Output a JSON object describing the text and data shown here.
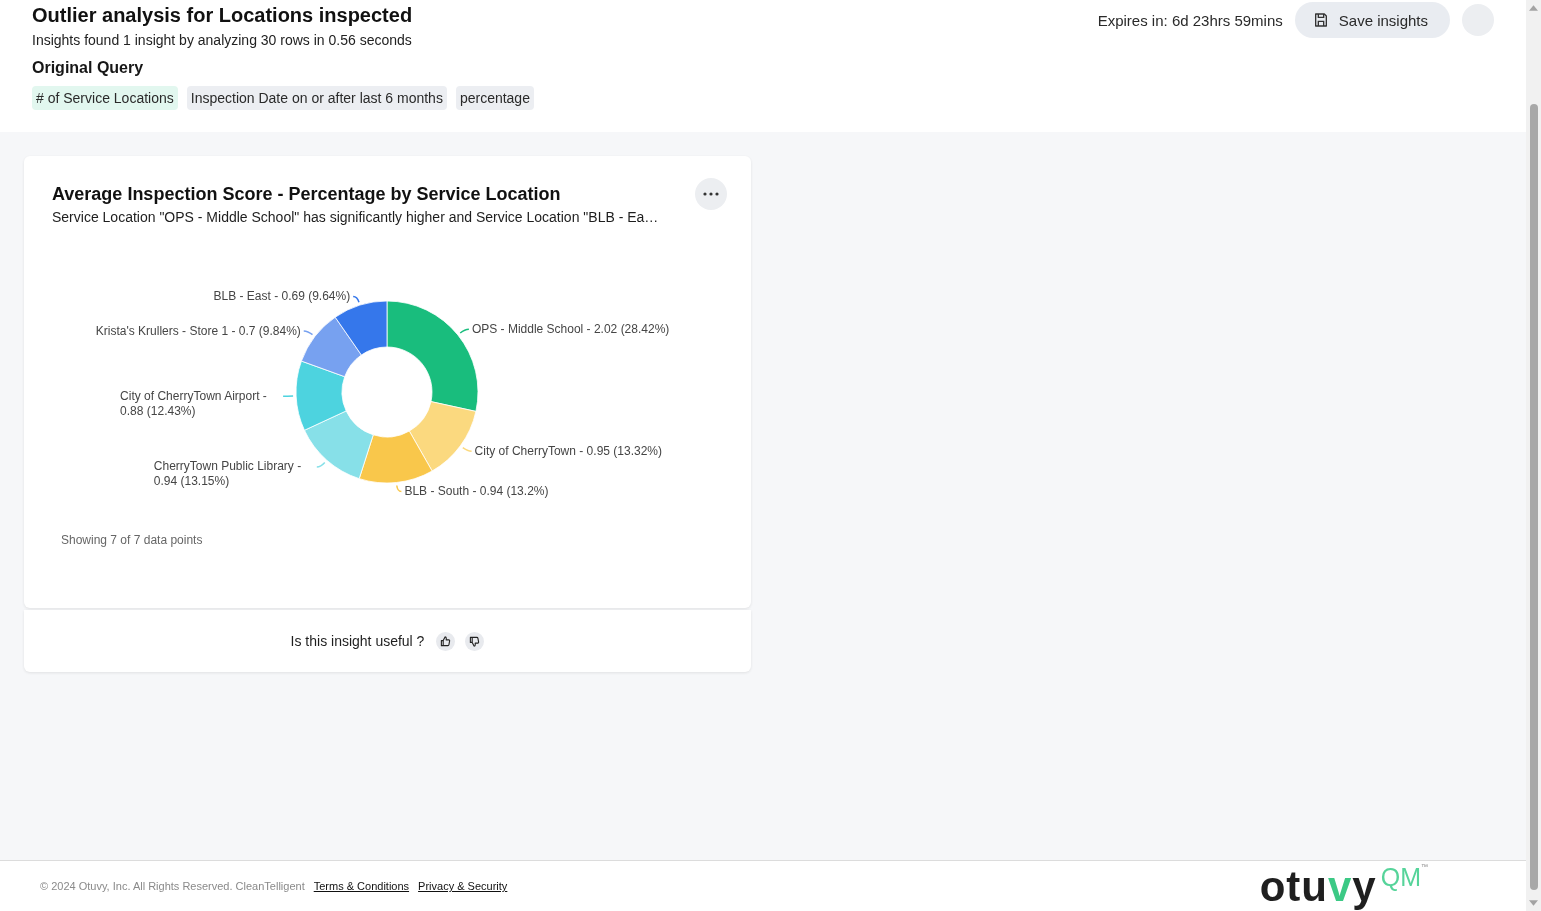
{
  "header": {
    "title": "Outlier analysis for Locations inspected",
    "summary": "Insights found 1 insight by analyzing 30 rows in 0.56 seconds",
    "expires": "Expires in: 6d 23hrs 59mins",
    "save_button": "Save insights",
    "query_heading": "Original Query",
    "query_tokens": [
      {
        "label": "# of Service Locations",
        "kind": "measure"
      },
      {
        "label": "Inspection Date on or after last 6 months",
        "kind": "filter"
      },
      {
        "label": "percentage",
        "kind": "keyword"
      }
    ]
  },
  "insight_card": {
    "description": "Service Location \"OPS - Middle School\" has significantly higher and Service Location \"BLB - Ea…",
    "chart_data": {
      "type": "donut",
      "title": "Average Inspection Score - Percentage by Service Location",
      "values": [
        28.42,
        13.32,
        13.2,
        13.15,
        12.43,
        9.84,
        9.64
      ],
      "value_labels": [
        "OPS - Middle School - 2.02 (28.42%)",
        "City of CherryTown - 0.95 (13.32%)",
        "BLB - South - 0.94 (13.2%)",
        "CherryTown Public Library - 0.94 (13.15%)",
        "City of CherryTown Airport - 0.88 (12.43%)",
        "Krista's Krullers - Store 1 - 0.7 (9.84%)",
        "BLB - East - 0.69 (9.64%)"
      ]
    },
    "note": "Showing 7 of 7 data points"
  },
  "feedback": {
    "question": "Is this insight useful ?"
  },
  "footer": {
    "copyright": "© 2024 Otuvy, Inc. All Rights Reserved. CleanTelligent",
    "links": [
      "Terms & Conditions",
      "Privacy & Security"
    ],
    "logo": {
      "wordmark": "otuvy",
      "suffix": "QM",
      "mark": "™"
    }
  }
}
